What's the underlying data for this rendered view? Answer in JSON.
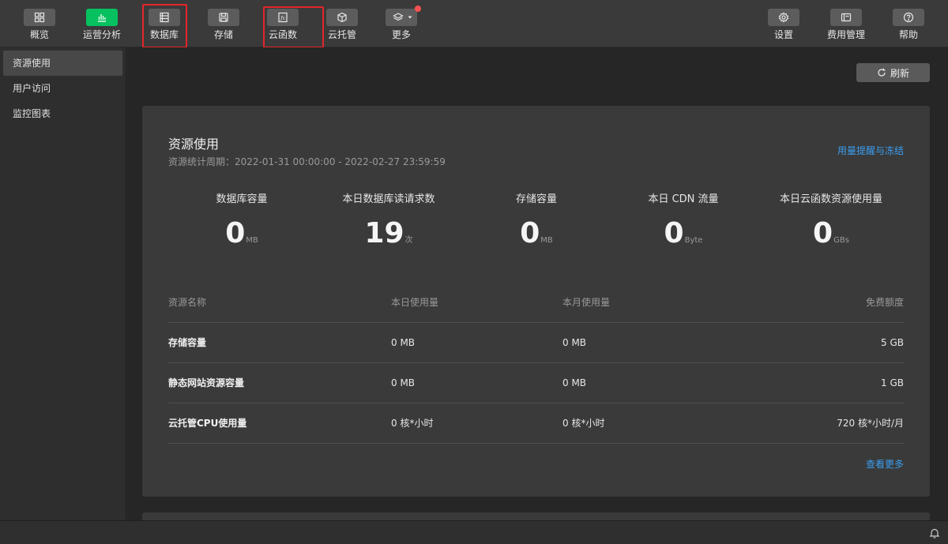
{
  "toolbar": {
    "left_items": [
      {
        "label": "概览",
        "icon": "grid-icon"
      },
      {
        "label": "运营分析",
        "icon": "bar-chart-icon"
      },
      {
        "label": "数据库",
        "icon": "database-icon"
      },
      {
        "label": "存储",
        "icon": "save-icon"
      },
      {
        "label": "云函数",
        "icon": "function-icon"
      },
      {
        "label": "云托管",
        "icon": "cube-icon"
      },
      {
        "label": "更多",
        "icon": "layers-icon"
      }
    ],
    "right_items": [
      {
        "label": "设置",
        "icon": "gear-icon"
      },
      {
        "label": "费用管理",
        "icon": "billing-icon"
      },
      {
        "label": "帮助",
        "icon": "help-icon"
      }
    ],
    "active_color": "#07c160",
    "highlight_color": "#e5252a"
  },
  "sidebar": {
    "items": [
      "资源使用",
      "用户访问",
      "监控图表"
    ]
  },
  "main": {
    "refresh_label": "刷新",
    "card": {
      "title": "资源使用",
      "subtitle": "资源统计周期：2022-01-31 00:00:00 - 2022-02-27 23:59:59",
      "link": "用量提醒与冻结",
      "stats": [
        {
          "label": "数据库容量",
          "value": "0",
          "unit": "MB"
        },
        {
          "label": "本日数据库读请求数",
          "value": "19",
          "unit": "次"
        },
        {
          "label": "存储容量",
          "value": "0",
          "unit": "MB"
        },
        {
          "label": "本日 CDN 流量",
          "value": "0",
          "unit": "Byte"
        },
        {
          "label": "本日云函数资源使用量",
          "value": "0",
          "unit": "GBs"
        }
      ],
      "table": {
        "headers": [
          "资源名称",
          "本日使用量",
          "本月使用量",
          "免费额度"
        ],
        "rows": [
          [
            "存储容量",
            "0 MB",
            "0 MB",
            "5 GB"
          ],
          [
            "静态网站资源容量",
            "0 MB",
            "0 MB",
            "1 GB"
          ],
          [
            "云托管CPU使用量",
            "0 核*小时",
            "0 核*小时",
            "720 核*小时/月"
          ]
        ]
      },
      "more_link": "查看更多"
    }
  }
}
